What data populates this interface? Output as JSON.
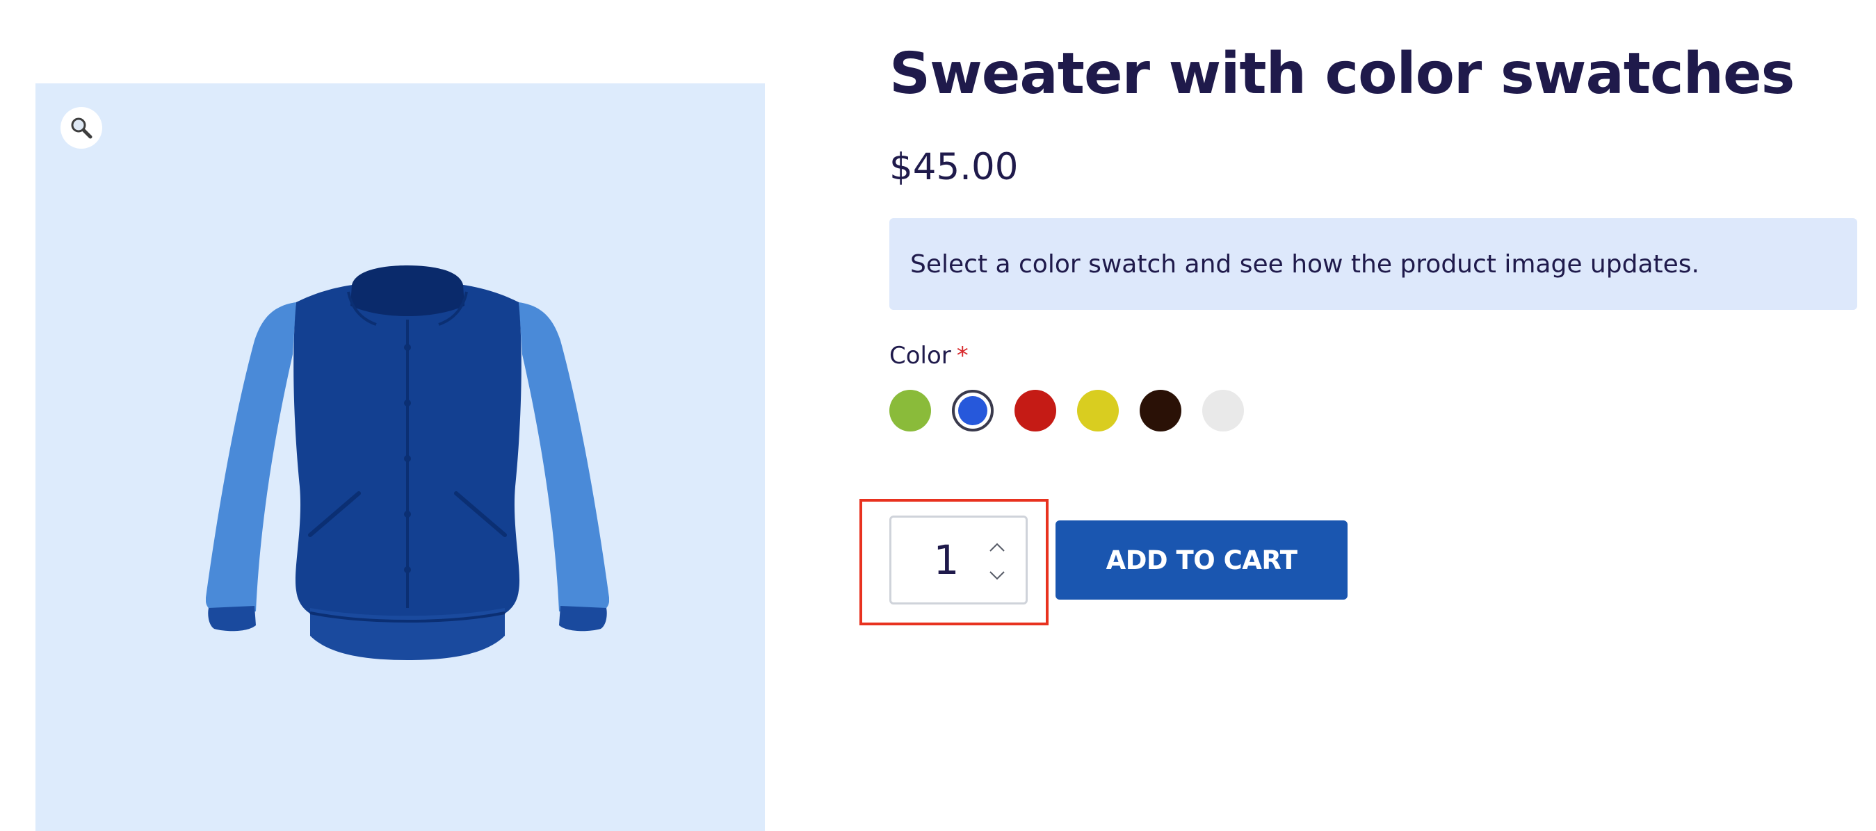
{
  "product": {
    "title": "Sweater with color swatches",
    "price": "$45.00",
    "notice": "Select a color swatch and see how the product image updates.",
    "image_icon": "varsity-jacket-image",
    "zoom_icon": "magnifier-icon"
  },
  "color": {
    "label": "Color",
    "required_mark": "*",
    "swatches": [
      {
        "color": "#8abb3a",
        "selected": false
      },
      {
        "color": "#2658db",
        "selected": true
      },
      {
        "color": "#c51b15",
        "selected": false
      },
      {
        "color": "#d9cd20",
        "selected": false
      },
      {
        "color": "#2a1106",
        "selected": false
      },
      {
        "color": "#e9e9e9",
        "selected": false
      }
    ]
  },
  "cart": {
    "quantity": "1",
    "add_to_cart_label": "ADD TO CART",
    "button_color": "#1a56b0",
    "highlight_color": "#e8321f"
  }
}
